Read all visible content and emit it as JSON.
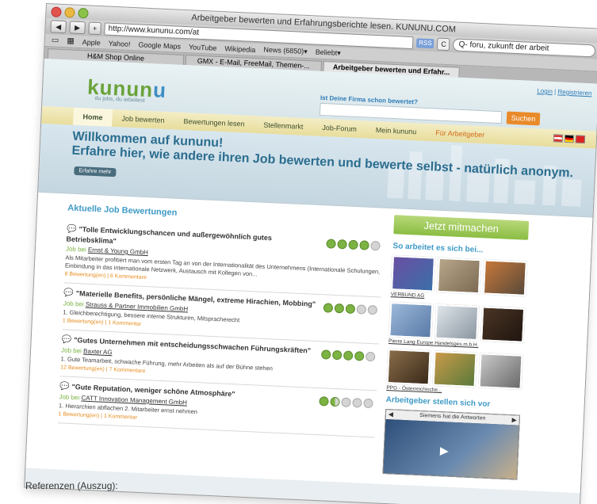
{
  "browser": {
    "window_title": "Arbeitgeber bewerten und Erfahrungsberichte lesen. KUNUNU.COM",
    "url": "http://www.kununu.com/at",
    "search_value": "Q- foru, zukunft der arbeit",
    "rss_label": "RSS",
    "bookmarks": [
      "Apple",
      "Yahoo!",
      "Google Maps",
      "YouTube",
      "Wikipedia",
      "News (6850)▾",
      "Beliebt▾"
    ],
    "tabs": [
      "H&M Shop Online",
      "GMX - E-Mail, FreeMail, Themen-...",
      "Arbeitgeber bewerten und Erfahr..."
    ]
  },
  "header": {
    "logo_a": "kunun",
    "logo_b": "u",
    "tagline": "du jobs, du arbeitest",
    "login": "Login",
    "register": "Registrieren",
    "question": "Ist Deine Firma schon bewertet?",
    "search_button": "Suchen"
  },
  "nav": [
    "Home",
    "Job bewerten",
    "Bewertungen lesen",
    "Stellenmarkt",
    "Job-Forum",
    "Mein kununu",
    "Für Arbeitgeber"
  ],
  "hero": {
    "title": "Willkommen auf kununu!",
    "subtitle": "Erfahre hier, wie andere ihren Job bewerten und bewerte selbst - natürlich anonym.",
    "more": "Erfahre mehr"
  },
  "reviews_title": "Aktuelle Job Bewertungen",
  "reviews": [
    {
      "title": "\"Tolle Entwicklungschancen und außergewöhnlich gutes Betriebsklima\"",
      "prefix": "Job bei",
      "company": "Ernst & Young GmbH",
      "text": "Als Mitarbeiter profitiert man vom ersten Tag an von der Internationalität des Unternehmens (Internationale Schulungen, Einbindung in das internationale Netzwerk, Austausch mit Kollegen von...",
      "count": "8 Bewertung(en) | 6 Kommentare",
      "rating": 4
    },
    {
      "title": "\"Materielle Benefits, persönliche Mängel, extreme Hirachien, Mobbing\"",
      "prefix": "Job bei",
      "company": "Strauss & Partner Immobilien GmbH",
      "text": "1. Gleichberechtigung, bessere interne Strukturen, Mitspracherecht",
      "count": "1 Bewertung(en) | 1 Kommentar",
      "rating": 3
    },
    {
      "title": "\"Gutes Unternehmen mit entscheidungsschwachen Führungskräften\"",
      "prefix": "Job bei",
      "company": "Baxter AG",
      "text": "1. Gute Teamarbeit, schwache Führung, mehr Arbeiten als auf der Bühne stehen",
      "count": "12 Bewertung(en) | 7 Kommentare",
      "rating": 4
    },
    {
      "title": "\"Gute Reputation, weniger schöne Atmosphäre\"",
      "prefix": "Job bei",
      "company": "CATT Innovation Management GmbH",
      "text": "1. Hierarchien abflachen 2. Mitarbeiter ernst nehmen",
      "count": "1 Bewertung(en) | 1 Kommentar",
      "rating": 1.5
    }
  ],
  "sidebar": {
    "join": "Jetzt mitmachen",
    "section1": "So arbeitet es sich bei...",
    "captions": [
      "VERBUND AG",
      "Pierre Lang Europe Handelsges.m.b.H.",
      "PPG - Österreichische..."
    ],
    "section2": "Arbeitgeber stellen sich vor",
    "video_title": "Siemens hat die Antworten"
  },
  "caption": "Referenzen (Auszug):"
}
